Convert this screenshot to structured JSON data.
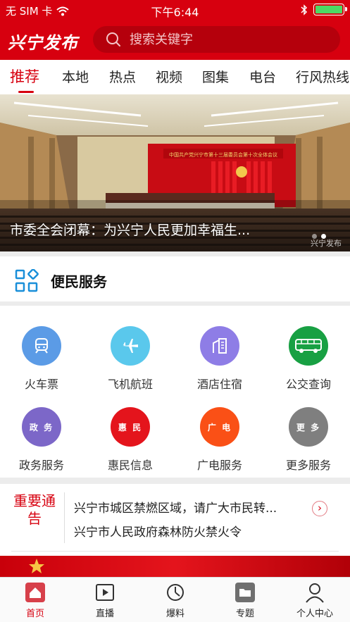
{
  "status_bar": {
    "carrier": "无 SIM 卡",
    "time": "下午6:44",
    "battery_level": 1.0,
    "battery_color": "#4cd964"
  },
  "header": {
    "logo": "兴宁发布",
    "search_placeholder": "搜索关键字",
    "bg_color": "#d7000f"
  },
  "tabs": [
    {
      "label": "推荐",
      "active": true
    },
    {
      "label": "本地"
    },
    {
      "label": "热点"
    },
    {
      "label": "视频"
    },
    {
      "label": "图集"
    },
    {
      "label": "电台"
    },
    {
      "label": "行风热线"
    }
  ],
  "banner": {
    "caption": "市委全会闭幕：为兴宁人民更加幸福生...",
    "watermark": "兴宁发布",
    "stage_text": "中国共产党兴宁市第十三届委员会第十次全体会议",
    "slides": 2,
    "active_slide": 2
  },
  "services": {
    "title": "便民服务",
    "items": [
      {
        "label": "火车票",
        "icon": "train-icon",
        "color": "#5b9be6"
      },
      {
        "label": "飞机航班",
        "icon": "airplane-icon",
        "color": "#5ac8ec"
      },
      {
        "label": "酒店住宿",
        "icon": "hotel-icon",
        "color": "#8e7de6"
      },
      {
        "label": "公交查询",
        "icon": "bus-icon",
        "color": "#18a043"
      },
      {
        "label": "政务服务",
        "icon_text": "政 务",
        "color": "#7c67c8"
      },
      {
        "label": "惠民信息",
        "icon_text": "惠 民",
        "color": "#e4141c"
      },
      {
        "label": "广电服务",
        "icon_text": "广 电",
        "color": "#fa5016"
      },
      {
        "label": "更多服务",
        "icon_text": "更 多",
        "color": "#7f7f7f"
      }
    ]
  },
  "notice": {
    "tag": "重要通告",
    "lines": [
      "兴宁市城区禁燃区域，请广大市民转...",
      "兴宁市人民政府森林防火禁火令"
    ]
  },
  "tabbar": [
    {
      "label": "首页",
      "icon": "home-icon",
      "active": true
    },
    {
      "label": "直播",
      "icon": "live-play-icon"
    },
    {
      "label": "爆料",
      "icon": "report-icon"
    },
    {
      "label": "专题",
      "icon": "topic-folder-icon"
    },
    {
      "label": "个人中心",
      "icon": "user-icon"
    }
  ]
}
